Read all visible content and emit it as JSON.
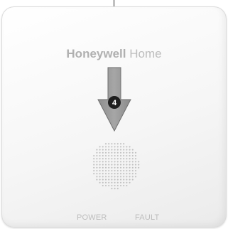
{
  "device": {
    "brand_bold": "Honeywell",
    "brand_light": "Home",
    "indicator_number": "4",
    "power_label": "POWER",
    "fault_label": "FAULT"
  },
  "colors": {
    "arrow_fill": "#9a9a9a",
    "badge": "#1e1e1e",
    "label_gray": "#bdbdbd"
  }
}
